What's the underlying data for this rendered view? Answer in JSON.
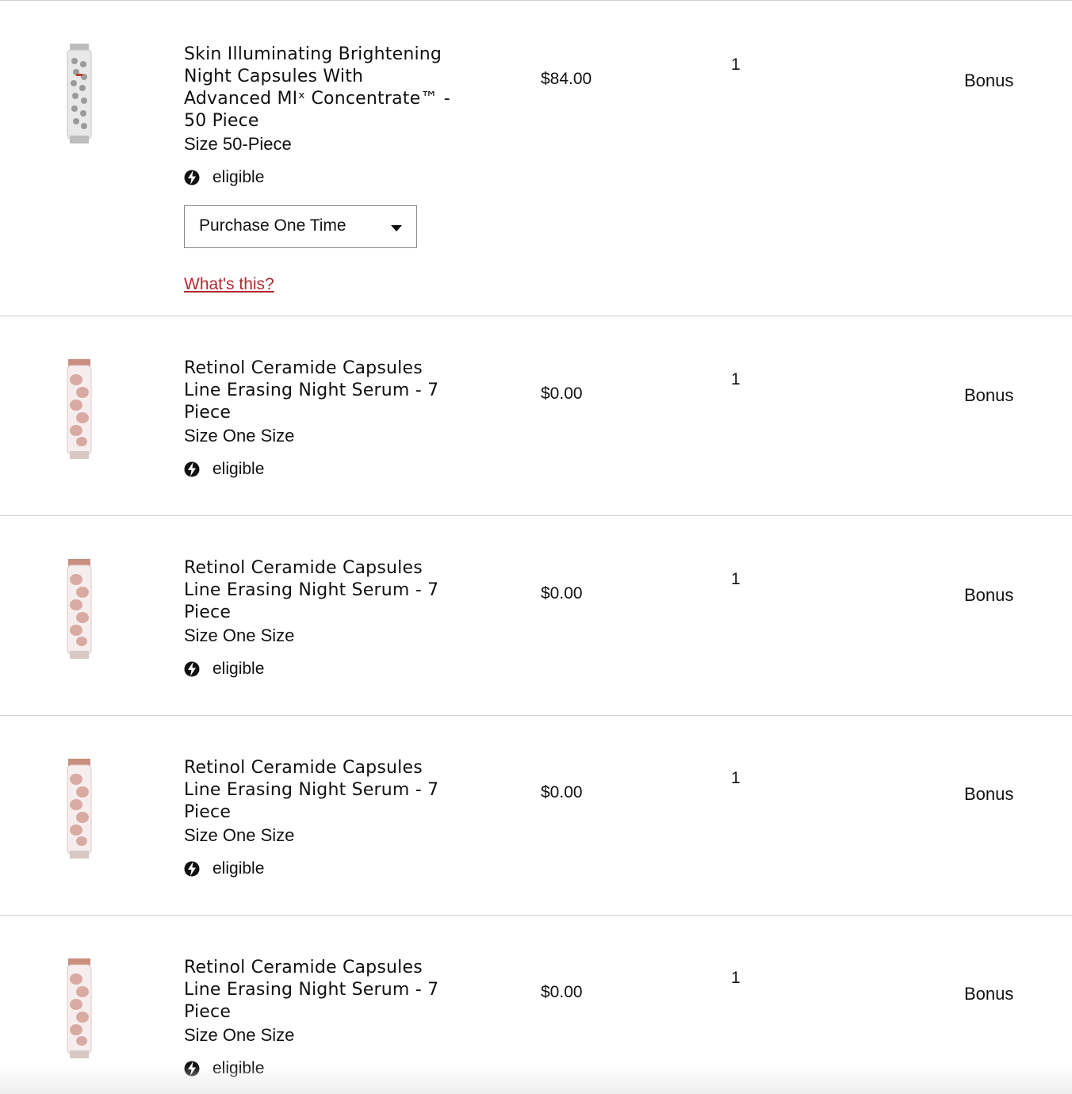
{
  "cart": {
    "items": [
      {
        "name_lines": [
          "Skin Illuminating Brightening",
          "Night Capsules With",
          "Advanced MIˣ Concentrate™ -",
          "50 Piece"
        ],
        "size": "Size 50-Piece",
        "eligible": "eligible",
        "price": "$84.00",
        "quantity": "1",
        "bonus": "Bonus",
        "purchase_option": "Purchase One Time",
        "help_link": "What's this?",
        "thumb_icon": "clear-capsule-bottle"
      },
      {
        "name_lines": [
          "Retinol Ceramide Capsules",
          "Line Erasing Night Serum - 7",
          "Piece"
        ],
        "size": "Size One Size",
        "eligible": "eligible",
        "price": "$0.00",
        "quantity": "1",
        "bonus": "Bonus",
        "thumb_icon": "pink-capsule-bottle"
      },
      {
        "name_lines": [
          "Retinol Ceramide Capsules",
          "Line Erasing Night Serum - 7",
          "Piece"
        ],
        "size": "Size One Size",
        "eligible": "eligible",
        "price": "$0.00",
        "quantity": "1",
        "bonus": "Bonus",
        "thumb_icon": "pink-capsule-bottle"
      },
      {
        "name_lines": [
          "Retinol Ceramide Capsules",
          "Line Erasing Night Serum - 7",
          "Piece"
        ],
        "size": "Size One Size",
        "eligible": "eligible",
        "price": "$0.00",
        "quantity": "1",
        "bonus": "Bonus",
        "thumb_icon": "pink-capsule-bottle"
      },
      {
        "name_lines": [
          "Retinol Ceramide Capsules",
          "Line Erasing Night Serum - 7",
          "Piece"
        ],
        "size": "Size One Size",
        "eligible": "eligible",
        "price": "$0.00",
        "quantity": "1",
        "bonus": "Bonus",
        "thumb_icon": "pink-capsule-bottle"
      }
    ]
  },
  "colors": {
    "link": "#b02a30",
    "divider": "#d0d0d0",
    "text": "#111111"
  }
}
